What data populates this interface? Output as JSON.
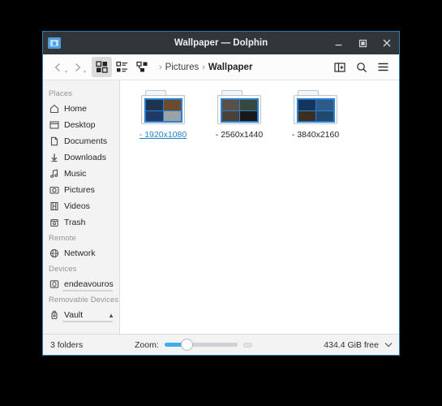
{
  "window": {
    "title": "Wallpaper — Dolphin",
    "app_icon": "folder-icon",
    "controls": {
      "minimize": "minimize-icon",
      "maximize": "maximize-icon",
      "close": "close-icon"
    }
  },
  "toolbar": {
    "back_label": "Back",
    "forward_label": "Forward",
    "view_modes": [
      {
        "name": "icons-view",
        "label": "Icons",
        "active": true
      },
      {
        "name": "compact-view",
        "label": "Compact",
        "active": false
      },
      {
        "name": "details-view",
        "label": "Details",
        "active": false
      }
    ],
    "breadcrumb": [
      {
        "label": "Pictures",
        "current": false
      },
      {
        "label": "Wallpaper",
        "current": true
      }
    ],
    "right_actions": [
      {
        "name": "split-view",
        "label": "Split"
      },
      {
        "name": "search",
        "label": "Find"
      },
      {
        "name": "menu",
        "label": "Control"
      }
    ]
  },
  "sidebar": {
    "sections": [
      {
        "heading": "Places",
        "items": [
          {
            "label": "Home",
            "icon": "home-icon"
          },
          {
            "label": "Desktop",
            "icon": "desktop-icon"
          },
          {
            "label": "Documents",
            "icon": "document-icon"
          },
          {
            "label": "Downloads",
            "icon": "download-icon"
          },
          {
            "label": "Music",
            "icon": "music-icon"
          },
          {
            "label": "Pictures",
            "icon": "picture-icon"
          },
          {
            "label": "Videos",
            "icon": "video-icon"
          },
          {
            "label": "Trash",
            "icon": "trash-icon"
          }
        ]
      },
      {
        "heading": "Remote",
        "items": [
          {
            "label": "Network",
            "icon": "network-icon"
          }
        ]
      },
      {
        "heading": "Devices",
        "items": [
          {
            "label": "endeavouros",
            "icon": "disk-icon",
            "capacity_percent": 10
          }
        ]
      },
      {
        "heading": "Removable Devices",
        "items": [
          {
            "label": "Vault",
            "icon": "usb-icon",
            "capacity_percent": 8,
            "eject": true
          }
        ]
      }
    ]
  },
  "content": {
    "files": [
      {
        "label": "- 1920x1080",
        "type": "folder",
        "hovered": true,
        "thumbs": [
          "#1e3350",
          "#6b4a2d",
          "#1d3b66",
          "#9aa2a8"
        ]
      },
      {
        "label": "- 2560x1440",
        "type": "folder",
        "hovered": false,
        "thumbs": [
          "#5a5048",
          "#35493f",
          "#4a4138",
          "#181818"
        ]
      },
      {
        "label": "- 3840x2160",
        "type": "folder",
        "hovered": false,
        "thumbs": [
          "#14345e",
          "#2d5a86",
          "#3a2f20",
          "#23486e"
        ]
      }
    ]
  },
  "statusbar": {
    "count_text": "3 folders",
    "zoom_label": "Zoom:",
    "zoom_value_percent": 26,
    "free_space": "434.4 GiB free",
    "expand_icon": "chevron-down-icon"
  },
  "colors": {
    "accent": "#3daee9",
    "titlebar_bg": "#31363b",
    "window_border": "#2b7fa8",
    "sidebar_bg": "#f3f3f3",
    "hover_text": "#2980c9"
  }
}
